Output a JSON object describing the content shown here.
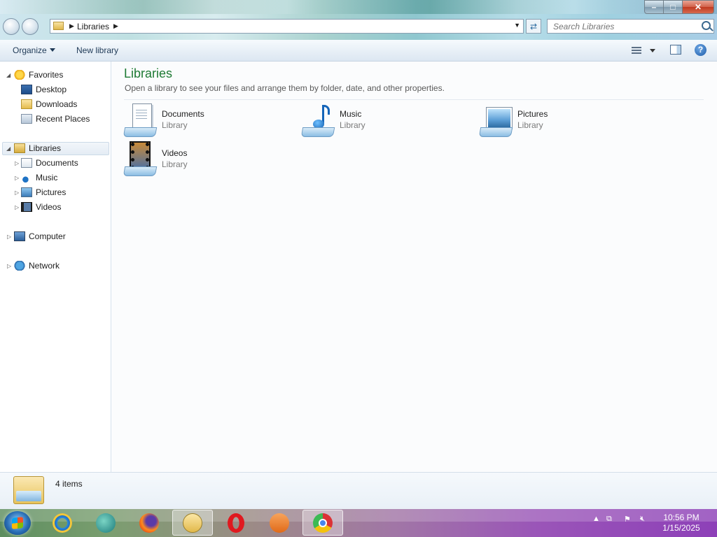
{
  "window": {
    "controls": {
      "minimize": "–",
      "maximize": "□",
      "close": "✕"
    }
  },
  "address": {
    "crumb": "Libraries",
    "search_placeholder": "Search Libraries"
  },
  "toolbar": {
    "organize_label": "Organize",
    "new_library_label": "New library",
    "help_label": "?"
  },
  "nav": {
    "favorites": {
      "label": "Favorites",
      "items": [
        {
          "label": "Desktop"
        },
        {
          "label": "Downloads"
        },
        {
          "label": "Recent Places"
        }
      ]
    },
    "libraries": {
      "label": "Libraries",
      "items": [
        {
          "label": "Documents"
        },
        {
          "label": "Music"
        },
        {
          "label": "Pictures"
        },
        {
          "label": "Videos"
        }
      ]
    },
    "computer": {
      "label": "Computer"
    },
    "network": {
      "label": "Network"
    }
  },
  "content": {
    "title": "Libraries",
    "subtitle": "Open a library to see your files and arrange them by folder, date, and other properties.",
    "libraries": [
      {
        "name": "Documents",
        "kind": "Library"
      },
      {
        "name": "Music",
        "kind": "Library"
      },
      {
        "name": "Pictures",
        "kind": "Library"
      },
      {
        "name": "Videos",
        "kind": "Library"
      }
    ]
  },
  "details": {
    "item_count": "4 items"
  },
  "taskbar": {
    "pinned": [
      "internet-explorer",
      "media-center",
      "firefox",
      "windows-explorer",
      "opera",
      "vlc",
      "chrome"
    ],
    "active": "windows-explorer"
  },
  "clock": {
    "time": "10:56 PM",
    "date": "1/15/2025"
  },
  "colors": {
    "title_green": "#1e7a34",
    "taskbar_start": "#5d8e5f",
    "taskbar_end": "#8d40b8"
  }
}
